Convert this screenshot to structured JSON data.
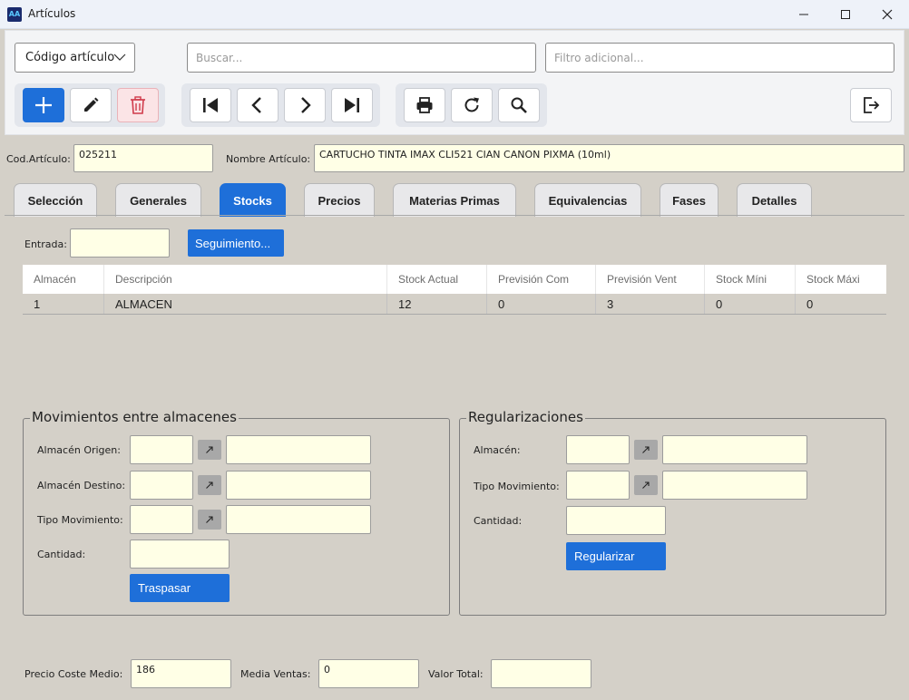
{
  "window": {
    "title": "Artículos",
    "app_icon_text": "AA"
  },
  "toolbar": {
    "search_type": "Código artículo",
    "search_placeholder": "Buscar...",
    "filter_placeholder": "Filtro adicional..."
  },
  "header": {
    "cod_label": "Cod.Artículo:",
    "cod_value": "025211",
    "name_label": "Nombre Artículo:",
    "name_value": "CARTUCHO TINTA IMAX CLI521 CIAN CANON PIXMA (10ml)"
  },
  "tabs": [
    {
      "label": "Selección"
    },
    {
      "label": "Generales"
    },
    {
      "label": "Stocks"
    },
    {
      "label": "Precios"
    },
    {
      "label": "Materias Primas"
    },
    {
      "label": "Equivalencias"
    },
    {
      "label": "Fases"
    },
    {
      "label": "Detalles"
    }
  ],
  "active_tab": "Stocks",
  "stocks": {
    "entrada_label": "Entrada:",
    "seguimiento_label": "Seguimiento...",
    "columns": [
      "Almacén",
      "Descripción",
      "Stock Actual",
      "Previsión Com",
      "Previsión Vent",
      "Stock Míni",
      "Stock Máxi"
    ],
    "rows": [
      [
        "1",
        "ALMACEN",
        "12",
        "0",
        "3",
        "0",
        "0"
      ]
    ]
  },
  "movimientos": {
    "title": "Movimientos entre almacenes",
    "origen_label": "Almacén Origen:",
    "destino_label": "Almacén Destino:",
    "tipo_label": "Tipo Movimiento:",
    "cantidad_label": "Cantidad:",
    "button_label": "Traspasar"
  },
  "regularizaciones": {
    "title": "Regularizaciones",
    "almacen_label": "Almacén:",
    "tipo_label": "Tipo Movimiento:",
    "cantidad_label": "Cantidad:",
    "button_label": "Regularizar"
  },
  "footer": {
    "precio_label": "Precio Coste Medio:",
    "precio_value": "186",
    "media_label": "Media Ventas:",
    "media_value": "0",
    "valor_label": "Valor Total:",
    "valor_value": ""
  },
  "colors": {
    "accent": "#1e6fd9",
    "background": "#d4d0c8",
    "field_bg": "#ffffe6"
  }
}
